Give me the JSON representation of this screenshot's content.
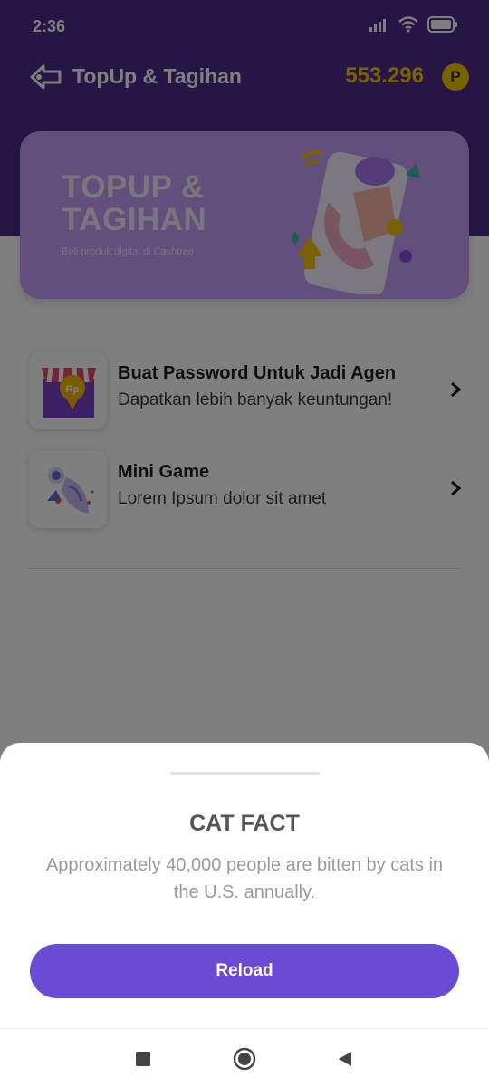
{
  "status_bar": {
    "time": "2:36",
    "icons": [
      "signal-icon",
      "wifi-icon",
      "battery-icon"
    ]
  },
  "app_bar": {
    "title": "TopUp & Tagihan",
    "points": "553.296",
    "points_badge": "P",
    "icons": [
      "back-logo-icon"
    ]
  },
  "banner": {
    "title": "TOPUP & TAGIHAN",
    "subtitle": "Beli produk digital di Cashtree"
  },
  "menu_items": [
    {
      "title": "Buat Password Untuk Jadi Agen",
      "subtitle": "Dapatkan lebih banyak keuntungan!",
      "icon": "store-icon",
      "badge": "Rp"
    },
    {
      "title": "Mini Game",
      "subtitle": "Lorem Ipsum dolor sit amet",
      "icon": "rocket-icon"
    }
  ],
  "sheet": {
    "title": "CAT FACT",
    "body": "Approximately 40,000 people are bitten by cats in the U.S. annually.",
    "button_label": "Reload"
  },
  "nav_bar": {
    "buttons": [
      "recent-apps-icon",
      "home-icon",
      "back-icon"
    ]
  },
  "colors": {
    "header": "#4a2c8a",
    "accent_button": "#6a4bd4",
    "points": "#f2c200",
    "banner": "#c79ef8"
  }
}
